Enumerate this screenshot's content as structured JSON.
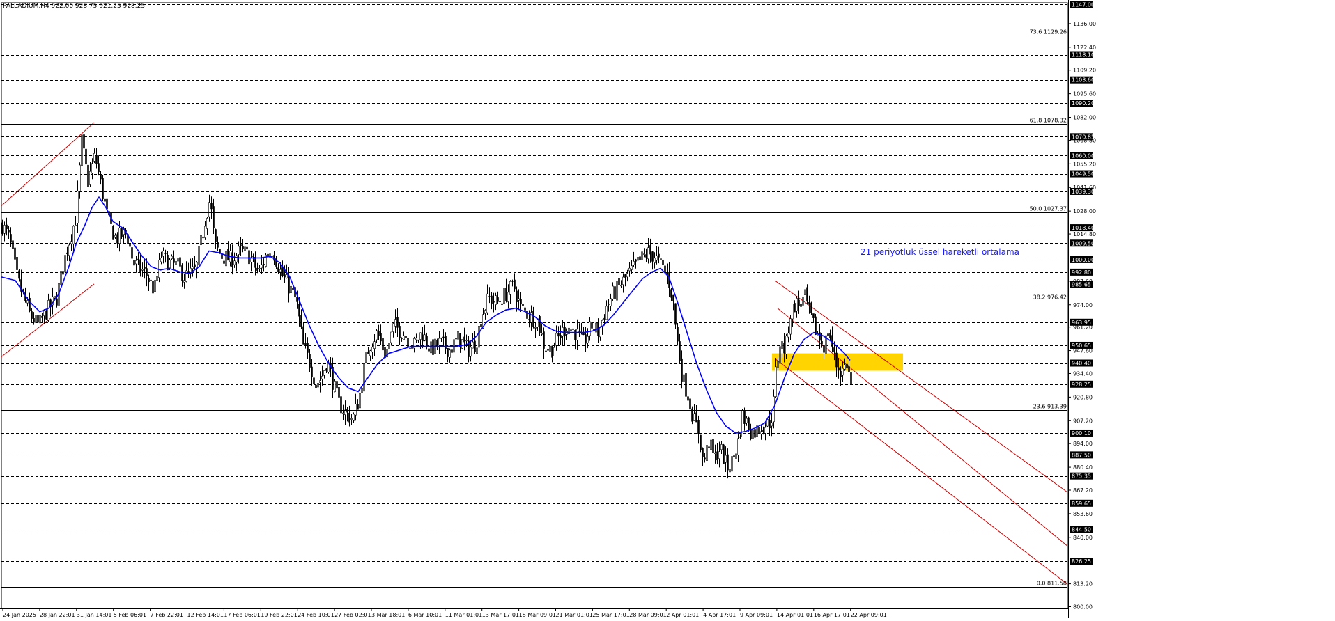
{
  "title": "PALLADIUM,H4  922.00 928.75 921.25 928.25",
  "annotation": "21 periyotluk üssel hareketli ortalama",
  "colors": {
    "candle": "#000000",
    "ema": "#0000ff",
    "annotation": "#1a1aff",
    "channel": "#cc0000",
    "zone": "#ffd400",
    "grid": "#000000",
    "badge_bg": "#000000",
    "badge_fg": "#ffffff"
  },
  "chart_data": {
    "type": "candlestick",
    "symbol": "PALLADIUM",
    "timeframe": "H4",
    "ohlc_header": {
      "open": 922.0,
      "high": 928.75,
      "low": 921.25,
      "close": 928.25
    },
    "current_price": 928.25,
    "y_range": [
      799,
      1148
    ],
    "x_range": [
      "2025-01-24",
      "2025-04-24"
    ],
    "axis_ticks": [
      1136.0,
      1122.4,
      1109.2,
      1095.6,
      1082.0,
      1068.8,
      1055.2,
      1041.6,
      1028.0,
      1014.8,
      987.6,
      974.0,
      961.2,
      947.6,
      934.4,
      920.8,
      907.2,
      894.0,
      880.4,
      867.2,
      853.6,
      840.0,
      813.2,
      800.0
    ],
    "level_badges": [
      1147.0,
      1118.1,
      1103.6,
      1090.2,
      1070.85,
      1060.0,
      1049.5,
      1039.3,
      1018.4,
      1009.5,
      1000.0,
      992.8,
      985.65,
      963.95,
      950.65,
      940.4,
      928.25,
      900.1,
      887.5,
      875.35,
      859.65,
      844.5,
      826.25
    ],
    "fib_levels": [
      {
        "label": "73.6 1129.26",
        "value": 1129.26
      },
      {
        "label": "61.8 1078.32",
        "value": 1078.32
      },
      {
        "label": "50.0 1027.37",
        "value": 1027.37
      },
      {
        "label": "38.2 976.42",
        "value": 976.42
      },
      {
        "label": "23.6 913.39",
        "value": 913.39
      },
      {
        "label": "0.0 811.58",
        "value": 811.58
      }
    ],
    "x_labels": [
      "24 Jan 2025",
      "28 Jan 22:01",
      "31 Jan 14:01",
      "5 Feb 06:01",
      "7 Feb 22:01",
      "12 Feb 14:01",
      "17 Feb 06:01",
      "19 Feb 22:01",
      "24 Feb 10:01",
      "27 Feb 02:01",
      "3 Mar 18:01",
      "6 Mar 10:01",
      "11 Mar 01:01",
      "13 Mar 17:01",
      "18 Mar 09:01",
      "21 Mar 01:01",
      "25 Mar 17:01",
      "28 Mar 09:01",
      "2 Apr 01:01",
      "4 Apr 17:01",
      "9 Apr 09:01",
      "14 Apr 01:01",
      "16 Apr 17:01",
      "22 Apr 09:01"
    ],
    "close_path": [
      [
        0,
        1020
      ],
      [
        10,
        1012
      ],
      [
        22,
        988
      ],
      [
        40,
        968
      ],
      [
        52,
        962
      ],
      [
        63,
        970
      ],
      [
        78,
        978
      ],
      [
        92,
        1005
      ],
      [
        106,
        1025
      ],
      [
        114,
        1068
      ],
      [
        123,
        1045
      ],
      [
        133,
        1060
      ],
      [
        143,
        1040
      ],
      [
        152,
        1022
      ],
      [
        163,
        1012
      ],
      [
        178,
        1016
      ],
      [
        188,
        998
      ],
      [
        206,
        992
      ],
      [
        218,
        982
      ],
      [
        228,
        1002
      ],
      [
        240,
        998
      ],
      [
        252,
        996
      ],
      [
        262,
        990
      ],
      [
        278,
        994
      ],
      [
        292,
        1025
      ],
      [
        298,
        1035
      ],
      [
        305,
        1008
      ],
      [
        315,
        1002
      ],
      [
        328,
        1000
      ],
      [
        342,
        1005
      ],
      [
        355,
        1002
      ],
      [
        368,
        992
      ],
      [
        378,
        1002
      ],
      [
        388,
        1006
      ],
      [
        400,
        992
      ],
      [
        412,
        984
      ],
      [
        422,
        976
      ],
      [
        432,
        950
      ],
      [
        442,
        940
      ],
      [
        450,
        928
      ],
      [
        458,
        932
      ],
      [
        466,
        942
      ],
      [
        474,
        930
      ],
      [
        482,
        918
      ],
      [
        492,
        912
      ],
      [
        503,
        908
      ],
      [
        512,
        920
      ],
      [
        518,
        935
      ],
      [
        526,
        950
      ],
      [
        538,
        958
      ],
      [
        550,
        945
      ],
      [
        562,
        962
      ],
      [
        575,
        958
      ],
      [
        590,
        950
      ],
      [
        602,
        958
      ],
      [
        615,
        948
      ],
      [
        628,
        952
      ],
      [
        642,
        948
      ],
      [
        655,
        955
      ],
      [
        668,
        948
      ],
      [
        680,
        952
      ],
      [
        688,
        968
      ],
      [
        698,
        978
      ],
      [
        710,
        975
      ],
      [
        722,
        980
      ],
      [
        734,
        985
      ],
      [
        744,
        972
      ],
      [
        756,
        968
      ],
      [
        768,
        965
      ],
      [
        778,
        950
      ],
      [
        788,
        948
      ],
      [
        798,
        955
      ],
      [
        810,
        962
      ],
      [
        822,
        958
      ],
      [
        834,
        952
      ],
      [
        846,
        962
      ],
      [
        856,
        958
      ],
      [
        866,
        972
      ],
      [
        876,
        980
      ],
      [
        886,
        985
      ],
      [
        896,
        990
      ],
      [
        906,
        995
      ],
      [
        916,
        1000
      ],
      [
        926,
        1004
      ],
      [
        936,
        1002
      ],
      [
        948,
        995
      ],
      [
        955,
        990
      ],
      [
        962,
        978
      ],
      [
        968,
        955
      ],
      [
        976,
        932
      ],
      [
        984,
        922
      ],
      [
        992,
        908
      ],
      [
        1000,
        900
      ],
      [
        1006,
        882
      ],
      [
        1014,
        895
      ],
      [
        1022,
        885
      ],
      [
        1030,
        892
      ],
      [
        1040,
        880
      ],
      [
        1048,
        884
      ],
      [
        1056,
        895
      ],
      [
        1062,
        910
      ],
      [
        1070,
        905
      ],
      [
        1076,
        900
      ],
      [
        1084,
        902
      ],
      [
        1092,
        905
      ],
      [
        1100,
        905
      ],
      [
        1106,
        912
      ],
      [
        1110,
        935
      ],
      [
        1116,
        952
      ],
      [
        1124,
        948
      ],
      [
        1130,
        968
      ],
      [
        1138,
        975
      ],
      [
        1144,
        974
      ],
      [
        1152,
        978
      ],
      [
        1158,
        970
      ],
      [
        1164,
        962
      ],
      [
        1172,
        955
      ],
      [
        1180,
        950
      ],
      [
        1186,
        960
      ],
      [
        1190,
        952
      ],
      [
        1196,
        940
      ],
      [
        1204,
        935
      ],
      [
        1212,
        940
      ],
      [
        1218,
        928
      ]
    ],
    "ema_path": [
      [
        0,
        990
      ],
      [
        20,
        988
      ],
      [
        40,
        976
      ],
      [
        55,
        970
      ],
      [
        68,
        972
      ],
      [
        82,
        980
      ],
      [
        96,
        995
      ],
      [
        108,
        1010
      ],
      [
        120,
        1020
      ],
      [
        130,
        1030
      ],
      [
        140,
        1036
      ],
      [
        150,
        1030
      ],
      [
        160,
        1022
      ],
      [
        175,
        1018
      ],
      [
        188,
        1010
      ],
      [
        202,
        1002
      ],
      [
        215,
        996
      ],
      [
        228,
        994
      ],
      [
        240,
        995
      ],
      [
        256,
        993
      ],
      [
        270,
        992
      ],
      [
        284,
        996
      ],
      [
        298,
        1005
      ],
      [
        312,
        1004
      ],
      [
        326,
        1002
      ],
      [
        342,
        1001
      ],
      [
        356,
        1001
      ],
      [
        372,
        1001
      ],
      [
        386,
        1002
      ],
      [
        400,
        998
      ],
      [
        414,
        990
      ],
      [
        428,
        976
      ],
      [
        442,
        962
      ],
      [
        456,
        950
      ],
      [
        470,
        940
      ],
      [
        484,
        932
      ],
      [
        498,
        926
      ],
      [
        512,
        924
      ],
      [
        526,
        932
      ],
      [
        540,
        940
      ],
      [
        556,
        946
      ],
      [
        572,
        948
      ],
      [
        588,
        950
      ],
      [
        604,
        950
      ],
      [
        620,
        950
      ],
      [
        636,
        950
      ],
      [
        652,
        950
      ],
      [
        668,
        951
      ],
      [
        682,
        956
      ],
      [
        696,
        964
      ],
      [
        710,
        968
      ],
      [
        724,
        971
      ],
      [
        738,
        972
      ],
      [
        752,
        970
      ],
      [
        766,
        967
      ],
      [
        780,
        962
      ],
      [
        794,
        959
      ],
      [
        808,
        958
      ],
      [
        822,
        958
      ],
      [
        836,
        958
      ],
      [
        850,
        959
      ],
      [
        864,
        962
      ],
      [
        878,
        968
      ],
      [
        892,
        975
      ],
      [
        906,
        982
      ],
      [
        920,
        989
      ],
      [
        934,
        993
      ],
      [
        946,
        995
      ],
      [
        958,
        990
      ],
      [
        970,
        976
      ],
      [
        984,
        958
      ],
      [
        998,
        940
      ],
      [
        1012,
        925
      ],
      [
        1026,
        912
      ],
      [
        1040,
        904
      ],
      [
        1054,
        900
      ],
      [
        1068,
        901
      ],
      [
        1082,
        903
      ],
      [
        1096,
        906
      ],
      [
        1110,
        916
      ],
      [
        1124,
        932
      ],
      [
        1138,
        946
      ],
      [
        1152,
        954
      ],
      [
        1166,
        958
      ],
      [
        1180,
        956
      ],
      [
        1194,
        952
      ],
      [
        1210,
        946
      ],
      [
        1218,
        942
      ]
    ],
    "zone": {
      "x_start": 1106,
      "x_end": 1294,
      "price_high": 946,
      "price_low": 936
    },
    "channels": [
      [
        [
          0,
          1031
        ],
        [
          133,
          1079
        ]
      ],
      [
        [
          0,
          944
        ],
        [
          133,
          986
        ]
      ],
      [
        [
          1110,
          988
        ],
        [
          1530,
          866
        ]
      ],
      [
        [
          1114,
          972
        ],
        [
          1530,
          835
        ]
      ],
      [
        [
          1110,
          943
        ],
        [
          1530,
          813
        ]
      ]
    ]
  }
}
